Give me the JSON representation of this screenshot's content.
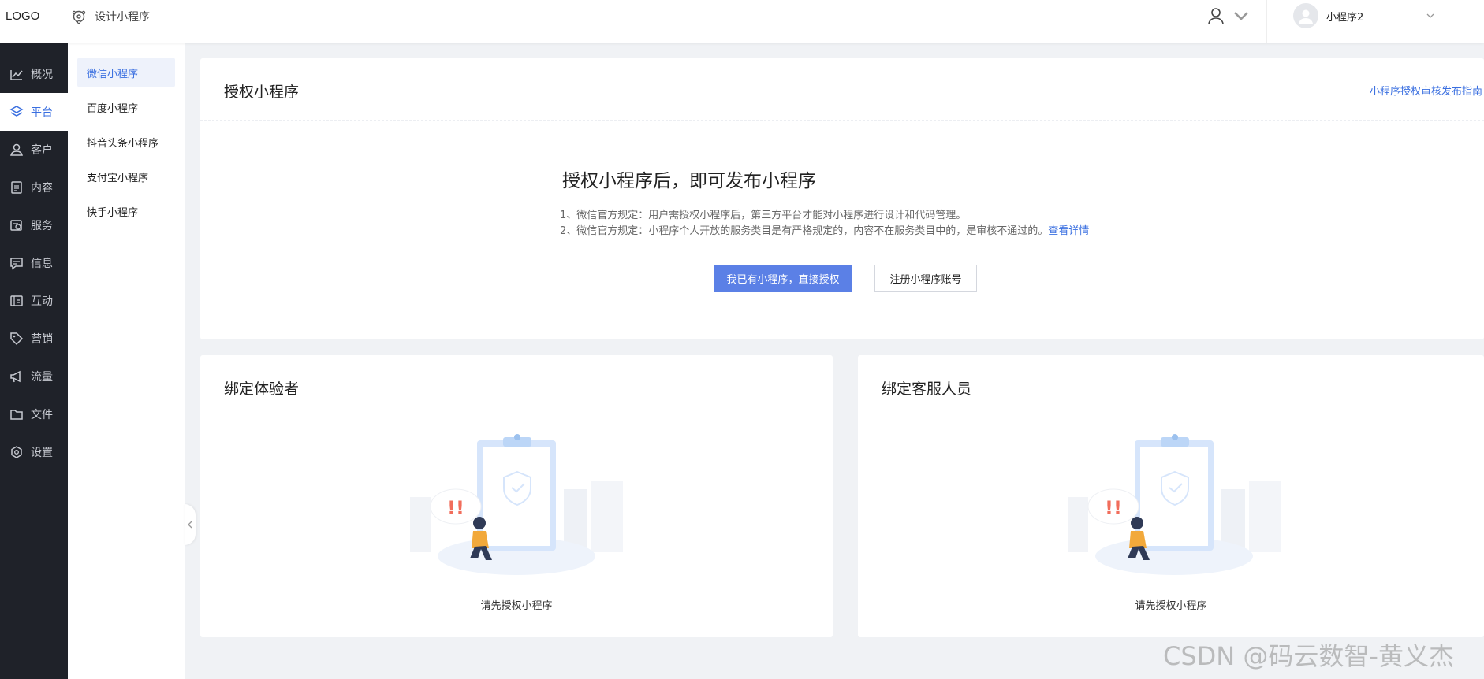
{
  "header": {
    "logo": "LOGO",
    "design_label": "设计小程序",
    "current_miniprogram": "小程序2"
  },
  "sidebar": {
    "items": [
      {
        "label": "概况",
        "icon": "chart-icon"
      },
      {
        "label": "平台",
        "icon": "layers-icon",
        "active": true
      },
      {
        "label": "客户",
        "icon": "user-icon"
      },
      {
        "label": "内容",
        "icon": "document-icon"
      },
      {
        "label": "服务",
        "icon": "service-icon"
      },
      {
        "label": "信息",
        "icon": "message-icon"
      },
      {
        "label": "互动",
        "icon": "interact-icon"
      },
      {
        "label": "营销",
        "icon": "tag-icon"
      },
      {
        "label": "流量",
        "icon": "megaphone-icon"
      },
      {
        "label": "文件",
        "icon": "folder-icon"
      },
      {
        "label": "设置",
        "icon": "settings-icon"
      }
    ]
  },
  "submenu": {
    "items": [
      {
        "label": "微信小程序",
        "active": true
      },
      {
        "label": "百度小程序"
      },
      {
        "label": "抖音头条小程序"
      },
      {
        "label": "支付宝小程序"
      },
      {
        "label": "快手小程序"
      }
    ]
  },
  "auth_card": {
    "title": "授权小程序",
    "guide_link": "小程序授权审核发布指南",
    "headline": "授权小程序后，即可发布小程序",
    "rule1": "1、微信官方规定：用户需授权小程序后，第三方平台才能对小程序进行设计和代码管理。",
    "rule2": "2、微信官方规定：小程序个人开放的服务类目是有严格规定的，内容不在服务类目中的，是审核不通过的。",
    "rule2_link": "查看详情",
    "primary_button": "我已有小程序，直接授权",
    "secondary_button": "注册小程序账号"
  },
  "tester_card": {
    "title": "绑定体验者",
    "empty_text": "请先授权小程序"
  },
  "service_card": {
    "title": "绑定客服人员",
    "empty_text": "请先授权小程序"
  },
  "watermark": "CSDN @码云数智-黄义杰",
  "colors": {
    "accent": "#3a6fe0",
    "primary_button": "#5b80e6",
    "sidebar_bg": "#1f2229",
    "page_bg": "#f0f2f5"
  }
}
